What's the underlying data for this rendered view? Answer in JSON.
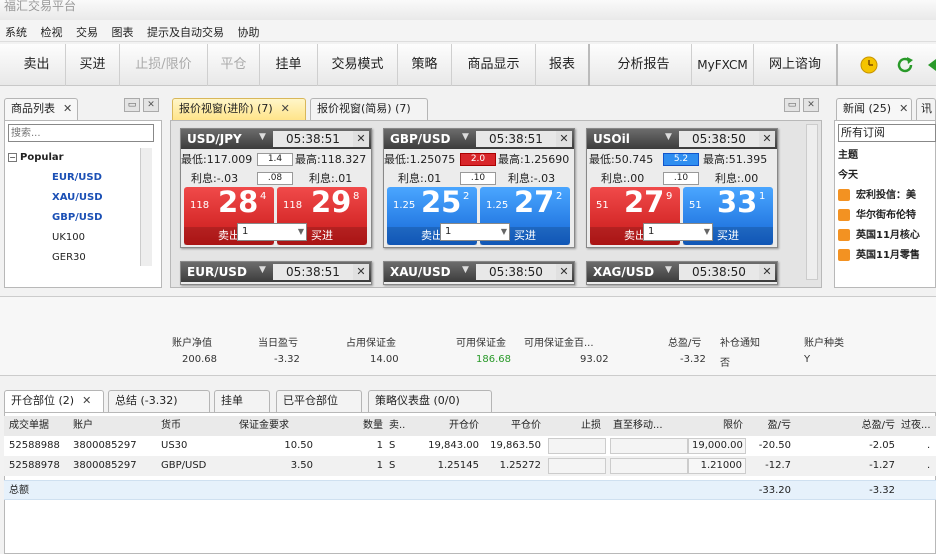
{
  "window_title": "福汇交易平台",
  "menu": [
    "系统",
    "检视",
    "交易",
    "图表",
    "提示及自动交易",
    "协助"
  ],
  "toolbar": {
    "sell": "卖出",
    "buy": "买进",
    "stop_limit": "止损/限价",
    "close": "平仓",
    "entry_order": "挂单",
    "trading_mode": "交易模式",
    "strategy": "策略",
    "product_display": "商品显示",
    "report": "报表",
    "analysis": "分析报告",
    "myfxcm": "MyFXCM",
    "live_chat": "网上谘询"
  },
  "products_panel": {
    "tab": "商品列表",
    "search_placeholder": "搜索...",
    "group": "Popular",
    "items": [
      "EUR/USD",
      "XAU/USD",
      "GBP/USD",
      "UK100",
      "GER30"
    ]
  },
  "quote_tabs": [
    "报价视窗(进阶) (7)",
    "报价视窗(简易) (7)"
  ],
  "tiles": [
    {
      "symbol": "USD/JPY",
      "time": "05:38:51",
      "low": "最低:117.009",
      "spread": "1.4",
      "spread_style": "plain",
      "high": "最高:118.327",
      "roll_sell": "利息:-.03",
      "mid": ".08",
      "roll_buy": "利息:.01",
      "sell_pre": "118",
      "sell_big": "28",
      "sell_sup": "4",
      "buy_pre": "118",
      "buy_big": "29",
      "buy_sup": "8",
      "buy_color": "red",
      "sell_label": "卖出",
      "buy_label": "买进",
      "qty": "1"
    },
    {
      "symbol": "GBP/USD",
      "time": "05:38:51",
      "low": "最低:1.25075",
      "spread": "2.0",
      "spread_style": "red",
      "high": "最高:1.25690",
      "roll_sell": "利息:.01",
      "mid": ".10",
      "roll_buy": "利息:-.03",
      "sell_pre": "1.25",
      "sell_big": "25",
      "sell_sup": "2",
      "buy_pre": "1.25",
      "buy_big": "27",
      "buy_sup": "2",
      "buy_color": "blue",
      "sell_color": "blue",
      "sell_label": "卖出",
      "buy_label": "买进",
      "qty": "1"
    },
    {
      "symbol": "USOil",
      "time": "05:38:50",
      "low": "最低:50.745",
      "spread": "5.2",
      "spread_style": "blue",
      "high": "最高:51.395",
      "roll_sell": "利息:.00",
      "mid": ".10",
      "roll_buy": "利息:.00",
      "sell_pre": "51",
      "sell_big": "27",
      "sell_sup": "9",
      "buy_pre": "51",
      "buy_big": "33",
      "buy_sup": "1",
      "buy_color": "blue",
      "sell_label": "卖出",
      "buy_label": "买进",
      "qty": "1"
    },
    {
      "symbol": "EUR/USD",
      "time": "05:38:51"
    },
    {
      "symbol": "XAU/USD",
      "time": "05:38:50"
    },
    {
      "symbol": "XAG/USD",
      "time": "05:38:50"
    }
  ],
  "news": {
    "tab": "新闻 (25)",
    "tab2": "讯",
    "filter": "所有订阅",
    "headline": "主题",
    "today": "今天",
    "items": [
      "宏利投信：美",
      "华尔街布伦特",
      "英国11月核心",
      "英国11月零售"
    ]
  },
  "account": {
    "headers": [
      "账户净值",
      "当日盈亏",
      "占用保证金",
      "可用保证金",
      "可用保证金百...",
      "总盈/亏",
      "补仓通知",
      "账户种类"
    ],
    "values": [
      "200.68",
      "-3.32",
      "14.00",
      "186.68",
      "93.02",
      "-3.32",
      "否",
      "Y"
    ],
    "available_color": "#2a9a2a"
  },
  "bottom_tabs": [
    "开仓部位 (2)",
    "总结 (-3.32)",
    "挂单",
    "已平仓部位",
    "策略仪表盘 (0/0)"
  ],
  "positions": {
    "columns": [
      "成交单据",
      "账户",
      "货币",
      "保证金要求",
      "数量",
      "卖..",
      "开仓价",
      "平仓价",
      "止损",
      "直至移动...",
      "限价",
      "盈/亏",
      "总盈/亏",
      "过夜..."
    ],
    "rows": [
      [
        "52588988",
        "3800085297",
        "US30",
        "10.50",
        "1",
        "S",
        "19,843.00",
        "19,863.50",
        "",
        "",
        "19,000.00",
        "-20.50",
        "-2.05",
        "."
      ],
      [
        "52588978",
        "3800085297",
        "GBP/USD",
        "3.50",
        "1",
        "S",
        "1.25145",
        "1.25272",
        "",
        "",
        "1.21000",
        "-12.7",
        "-1.27",
        "."
      ]
    ],
    "total_label": "总额",
    "total_pl": "-33.20",
    "total_gross": "-3.32"
  }
}
